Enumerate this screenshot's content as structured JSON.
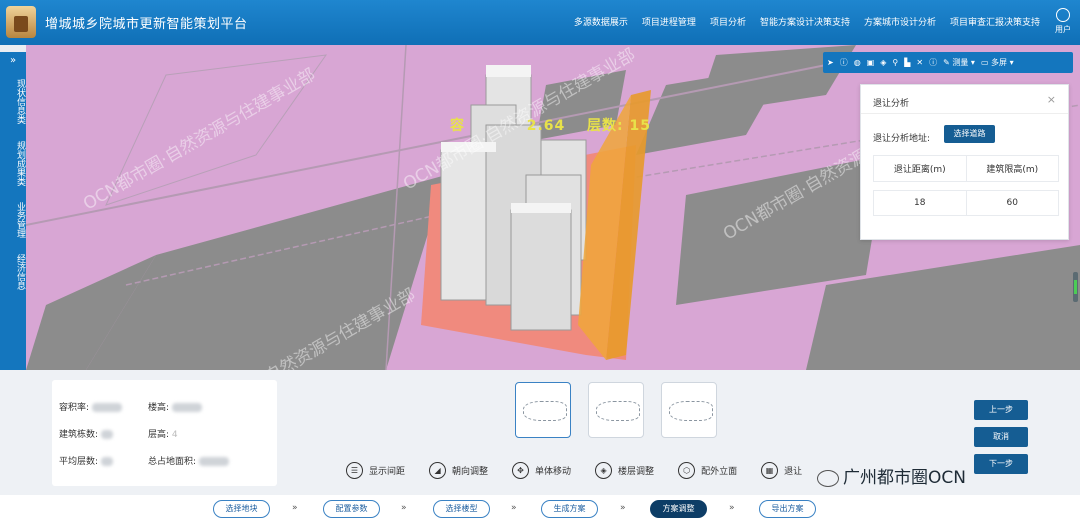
{
  "header": {
    "title": "增城城乡院城市更新智能策划平台",
    "nav": [
      "多源数据展示",
      "项目进程管理",
      "项目分析",
      "智能方案设计决策支持",
      "方案城市设计分析",
      "项目审查汇报决策支持"
    ],
    "user_label": "用户"
  },
  "sidebar": {
    "items": [
      "现状信息类",
      "规划成果类",
      "业务管理",
      "经济信息"
    ]
  },
  "map": {
    "overlay_text_a": "容",
    "overlay_text_b": "2.64",
    "overlay_text_c": "层数: 15",
    "watermark": "OCN都市圈·自然资源与住建事业部"
  },
  "toolbar": {
    "measure_label": "测量",
    "multiscreen_label": "多屏"
  },
  "panel": {
    "title": "退让分析",
    "label": "退让分析地址:",
    "select_button": "选择道路",
    "col_distance": "退让距离(m)",
    "col_limit": "建筑限高(m)",
    "val_distance": "18",
    "val_limit": "60"
  },
  "metrics": {
    "far_label": "容积率:",
    "height_label": "楼高:",
    "count_label": "建筑栋数:",
    "floor_height_label": "层高:",
    "floor_height_value": "4",
    "avg_floors_label": "平均层数:",
    "footprint_label": "总占地面积:"
  },
  "tools": [
    "显示间距",
    "朝向调整",
    "单体移动",
    "楼层调整",
    "配外立面",
    "退让"
  ],
  "side_buttons": [
    "上一步",
    "取消",
    "下一步"
  ],
  "steps": [
    "选择地块",
    "配置参数",
    "选择楼型",
    "生成方案",
    "方案调整",
    "导出方案"
  ],
  "brand": "广州都市圈OCN",
  "colors": {
    "header": "#1476be",
    "accent": "#155d93",
    "map_bg": "#d8a6d4"
  }
}
